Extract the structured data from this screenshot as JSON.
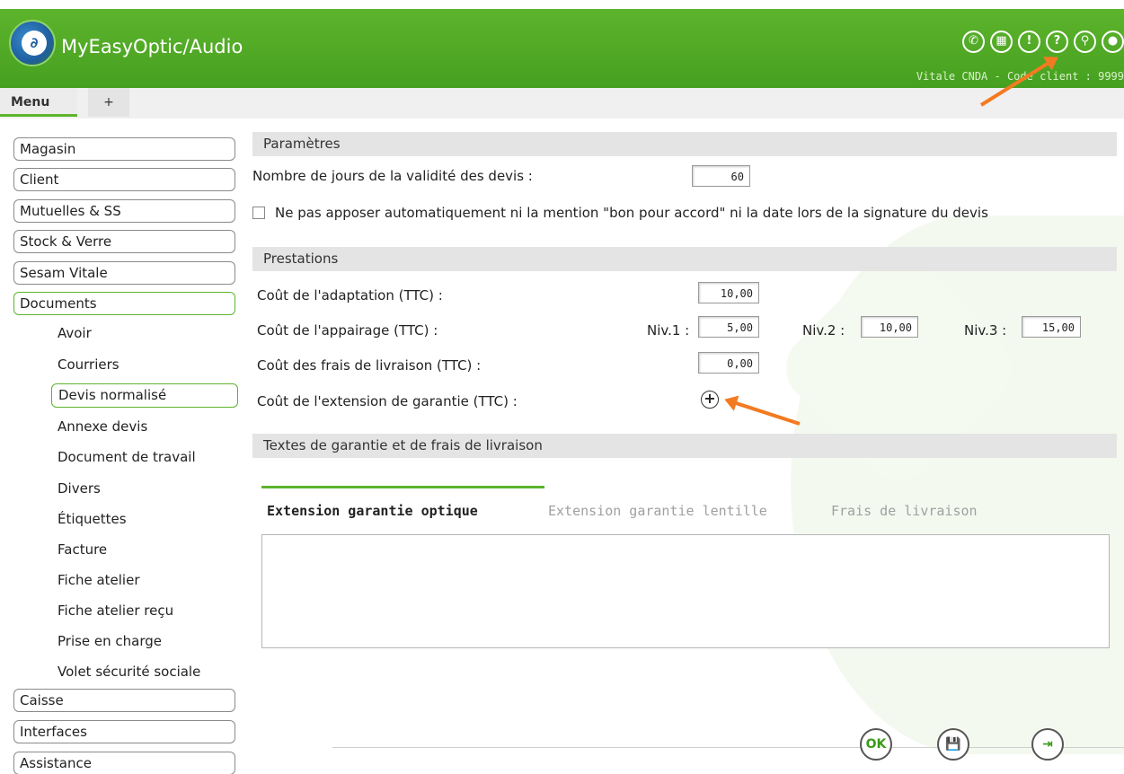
{
  "header": {
    "app_title": "MyEasyOptic/Audio",
    "status": "Vitale CNDA - Code client : 9999",
    "icons": [
      "phone-icon",
      "calendar-icon",
      "alert-icon",
      "help-icon",
      "support-icon",
      "user-icon"
    ]
  },
  "tabs": {
    "menu": "Menu",
    "add": "+"
  },
  "sidebar": {
    "items": {
      "magasin": "Magasin",
      "client": "Client",
      "mutuelles": "Mutuelles & SS",
      "stock": "Stock & Verre",
      "sesam": "Sesam Vitale",
      "documents": "Documents",
      "caisse": "Caisse",
      "interfaces": "Interfaces",
      "assistance": "Assistance"
    },
    "sub_items": {
      "avoir": "Avoir",
      "courriers": "Courriers",
      "devis": "Devis normalisé",
      "annexe": "Annexe devis",
      "doc_travail": "Document de travail",
      "divers": "Divers",
      "etiquettes": "Étiquettes",
      "facture": "Facture",
      "fiche_atelier": "Fiche atelier",
      "fiche_recu": "Fiche atelier reçu",
      "prise": "Prise en charge",
      "volet": "Volet sécurité sociale"
    }
  },
  "parametres": {
    "title": "Paramètres",
    "validity_label": "Nombre de jours de la validité des devis :",
    "validity_value": "60",
    "checkbox_label": "Ne pas apposer automatiquement ni la mention \"bon pour accord\" ni la date lors de la signature du devis"
  },
  "prestations": {
    "title": "Prestations",
    "adaptation_label": "Coût de l'adaptation (TTC) :",
    "adaptation_value": "10,00",
    "appairage_label": "Coût de l'appairage (TTC) :",
    "niv1_label": "Niv.1 :",
    "niv1_value": "5,00",
    "niv2_label": "Niv.2 :",
    "niv2_value": "10,00",
    "niv3_label": "Niv.3 :",
    "niv3_value": "15,00",
    "livraison_label": "Coût des frais de livraison (TTC) :",
    "livraison_value": "0,00",
    "extension_label": "Coût de l'extension de garantie (TTC) :"
  },
  "textes": {
    "title": "Textes de garantie et de frais de livraison",
    "tabs": {
      "optique": "Extension garantie optique",
      "lentille": "Extension garantie lentille",
      "livraison": "Frais de livraison"
    }
  },
  "footer": {
    "ok": "OK",
    "save": "💾",
    "exit": "⇥"
  },
  "colors": {
    "brand_green": "#5db42c",
    "annotation_orange": "#f37a21"
  }
}
